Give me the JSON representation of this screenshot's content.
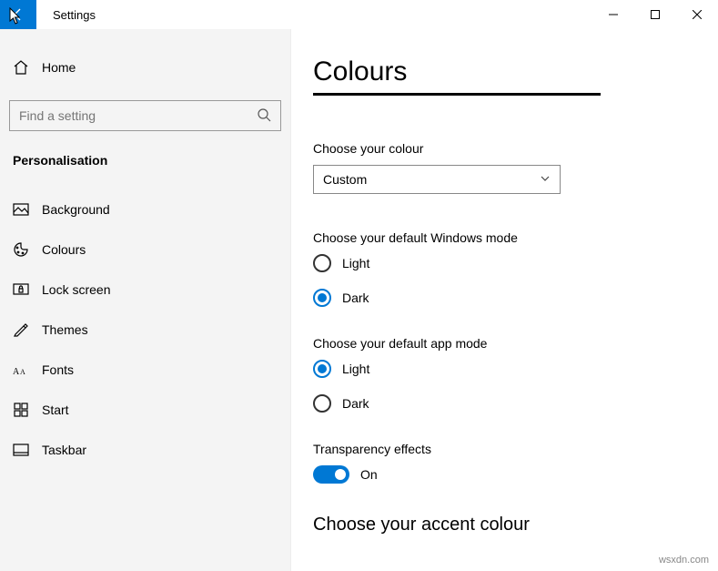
{
  "window": {
    "title": "Settings"
  },
  "sidebar": {
    "home": "Home",
    "search_placeholder": "Find a setting",
    "category": "Personalisation",
    "items": [
      {
        "label": "Background"
      },
      {
        "label": "Colours"
      },
      {
        "label": "Lock screen"
      },
      {
        "label": "Themes"
      },
      {
        "label": "Fonts"
      },
      {
        "label": "Start"
      },
      {
        "label": "Taskbar"
      }
    ]
  },
  "page": {
    "title": "Colours",
    "choose_colour_label": "Choose your colour",
    "choose_colour_value": "Custom",
    "windows_mode": {
      "label": "Choose your default Windows mode",
      "options": [
        {
          "label": "Light",
          "selected": false
        },
        {
          "label": "Dark",
          "selected": true
        }
      ]
    },
    "app_mode": {
      "label": "Choose your default app mode",
      "options": [
        {
          "label": "Light",
          "selected": true
        },
        {
          "label": "Dark",
          "selected": false
        }
      ]
    },
    "transparency": {
      "label": "Transparency effects",
      "state": "On"
    },
    "accent_heading": "Choose your accent colour"
  },
  "watermark": "wsxdn.com"
}
